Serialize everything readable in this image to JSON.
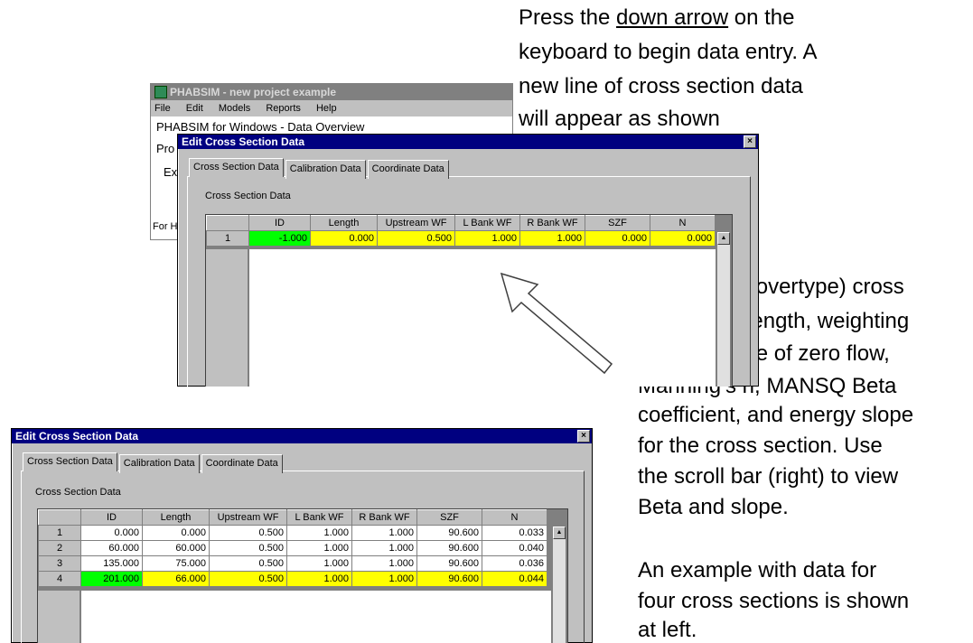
{
  "instructions": {
    "line1_pre": "Press the ",
    "line1_link": "down arrow",
    "line1_post": " on the",
    "line2": "keyboard to begin data entry. A",
    "line3": "new line of cross section data",
    "line4": "will appear as shown",
    "then_lines": [
      "Then enter (overtype) cross",
      "section ID, length, weighting",
      "factors, stage of zero flow,",
      "Manning’s n, MANSQ Beta",
      "coefficient, and energy slope",
      "for the cross section.  Use",
      "the scroll bar (right) to view",
      "Beta and slope."
    ],
    "example_lines": [
      "An example with data for",
      "four cross sections is shown",
      "at left."
    ]
  },
  "main_window": {
    "title": "PHABSIM - new project example",
    "menu": [
      "File",
      "Edit",
      "Models",
      "Reports",
      "Help"
    ],
    "body_fragments": [
      "PHABSIM for Windows - Data Overview",
      "Pro",
      "Ex",
      "For H"
    ]
  },
  "dialog": {
    "title": "Edit Cross Section Data",
    "close_label": "×",
    "tabs": [
      "Cross Section Data",
      "Calibration Data",
      "Coordinate Data"
    ],
    "group_label": "Cross Section Data",
    "columns": [
      "ID",
      "Length",
      "Upstream WF",
      "L Bank WF",
      "R Bank WF",
      "SZF",
      "N"
    ]
  },
  "grid_top": {
    "rows": [
      {
        "num": "1",
        "cells": [
          "-1.000",
          "0.000",
          "0.500",
          "1.000",
          "1.000",
          "0.000",
          "0.000"
        ]
      }
    ]
  },
  "grid_bottom": {
    "rows": [
      {
        "num": "1",
        "cells": [
          "0.000",
          "0.000",
          "0.500",
          "1.000",
          "1.000",
          "90.600",
          "0.033"
        ]
      },
      {
        "num": "2",
        "cells": [
          "60.000",
          "60.000",
          "0.500",
          "1.000",
          "1.000",
          "90.600",
          "0.040"
        ]
      },
      {
        "num": "3",
        "cells": [
          "135.000",
          "75.000",
          "0.500",
          "1.000",
          "1.000",
          "90.600",
          "0.036"
        ]
      },
      {
        "num": "4",
        "cells": [
          "201.000",
          "66.000",
          "0.500",
          "1.000",
          "1.000",
          "90.600",
          "0.044"
        ]
      }
    ]
  },
  "colors": {
    "new_row": "#ffff00",
    "id_cell": "#00ff00",
    "titlebar": "#000080"
  }
}
